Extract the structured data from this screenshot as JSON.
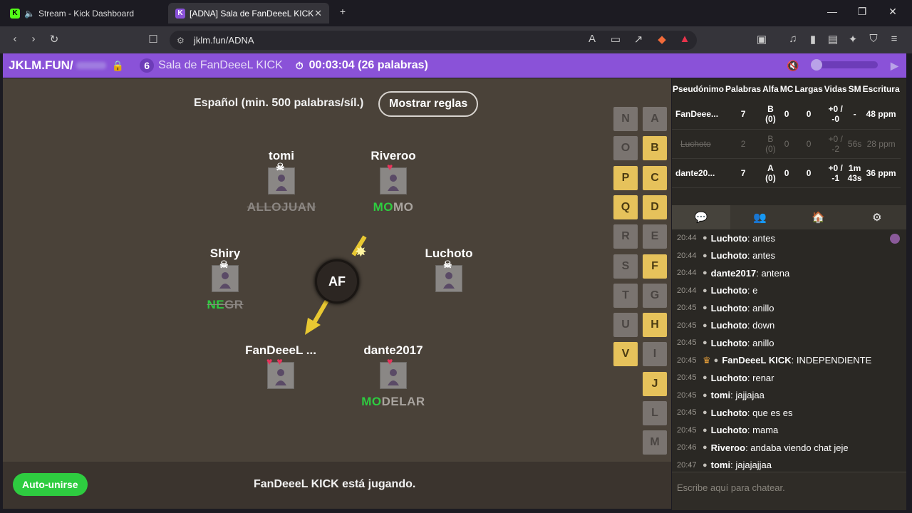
{
  "browser": {
    "tabs": [
      {
        "title": "Stream - Kick Dashboard"
      },
      {
        "title": "[ADNA] Sala de FanDeeeL KICK"
      }
    ],
    "url": "jklm.fun/ADNA"
  },
  "gamebar": {
    "site": "JKLM.FUN/",
    "room_count": "6",
    "room_name": "Sala de FanDeeeL KICK",
    "timer": "00:03:04 (26 palabras)"
  },
  "game": {
    "rules_text": "Español (min. 500 palabras/síl.)",
    "rules_button": "Mostrar reglas",
    "syllable": "AF",
    "players": [
      {
        "name": "tomi",
        "status": "dead",
        "word": "ALLOJUAN",
        "word_hl": ""
      },
      {
        "name": "Riveroo",
        "status": "1 life",
        "word_hl": "MO",
        "word": "MO"
      },
      {
        "name": "Shiry",
        "status": "dead",
        "word_hl": "NE",
        "word": "GR"
      },
      {
        "name": "Luchoto",
        "status": "dead",
        "word": "",
        "word_hl": ""
      },
      {
        "name": "FanDeeeL ...",
        "status": "2 lives",
        "word": "",
        "word_hl": ""
      },
      {
        "name": "dante2017",
        "status": "1 life",
        "word_hl": "MO",
        "word": "DELAR"
      }
    ],
    "letters_left": [
      "N",
      "O",
      "P",
      "Q",
      "R",
      "S",
      "T",
      "U",
      "V"
    ],
    "letters_right": [
      "A",
      "B",
      "C",
      "D",
      "E",
      "F",
      "G",
      "H",
      "I",
      "J",
      "L",
      "M"
    ],
    "letters_used": [
      "P",
      "Q",
      "V",
      "B",
      "C",
      "D",
      "F",
      "H",
      "J"
    ]
  },
  "footer": {
    "autojoin": "Auto-unirse",
    "status": "FanDeeeL KICK está jugando."
  },
  "stats": {
    "headers": [
      "Pseudónimo",
      "Palabras",
      "Alfa",
      "MC",
      "Largas",
      "Vidas",
      "SM",
      "Escritura"
    ],
    "rows": [
      {
        "name": "FanDeee...",
        "words": "7",
        "alfa": "B (0)",
        "mc": "0",
        "long": "0",
        "lives": "+0 / -0",
        "sm": "-",
        "speed": "48 ppm"
      },
      {
        "name": "Luchoto",
        "words": "2",
        "alfa": "B (0)",
        "mc": "0",
        "long": "0",
        "lives": "+0 / -2",
        "sm": "56s",
        "speed": "28 ppm"
      },
      {
        "name": "dante20...",
        "words": "7",
        "alfa": "A (0)",
        "mc": "0",
        "long": "0",
        "lives": "+0 / -1",
        "sm": "1m 43s",
        "speed": "36 ppm"
      }
    ]
  },
  "chat": {
    "messages": [
      {
        "time": "20:44",
        "user": "Luchoto",
        "text": "antes"
      },
      {
        "time": "20:44",
        "user": "Luchoto",
        "text": "antes"
      },
      {
        "time": "20:44",
        "user": "dante2017",
        "text": "antena"
      },
      {
        "time": "20:44",
        "user": "Luchoto",
        "text": "e"
      },
      {
        "time": "20:45",
        "user": "Luchoto",
        "text": "anillo"
      },
      {
        "time": "20:45",
        "user": "Luchoto",
        "text": "down"
      },
      {
        "time": "20:45",
        "user": "Luchoto",
        "text": "anillo"
      },
      {
        "time": "20:45",
        "user": "FanDeeeL KICK",
        "text": "INDEPENDIENTE"
      },
      {
        "time": "20:45",
        "user": "Luchoto",
        "text": "renar"
      },
      {
        "time": "20:45",
        "user": "tomi",
        "text": "jajjajaa"
      },
      {
        "time": "20:45",
        "user": "Luchoto",
        "text": "que es es"
      },
      {
        "time": "20:45",
        "user": "Luchoto",
        "text": "mama"
      },
      {
        "time": "20:46",
        "user": "Riveroo",
        "text": "andaba viendo chat jeje"
      },
      {
        "time": "20:47",
        "user": "tomi",
        "text": "jajajajjaa"
      }
    ],
    "placeholder": "Escribe aquí para chatear."
  },
  "colors": {
    "accent": "#8a52d8",
    "green": "#2ecc40",
    "letter_on": "#e6c25b"
  }
}
